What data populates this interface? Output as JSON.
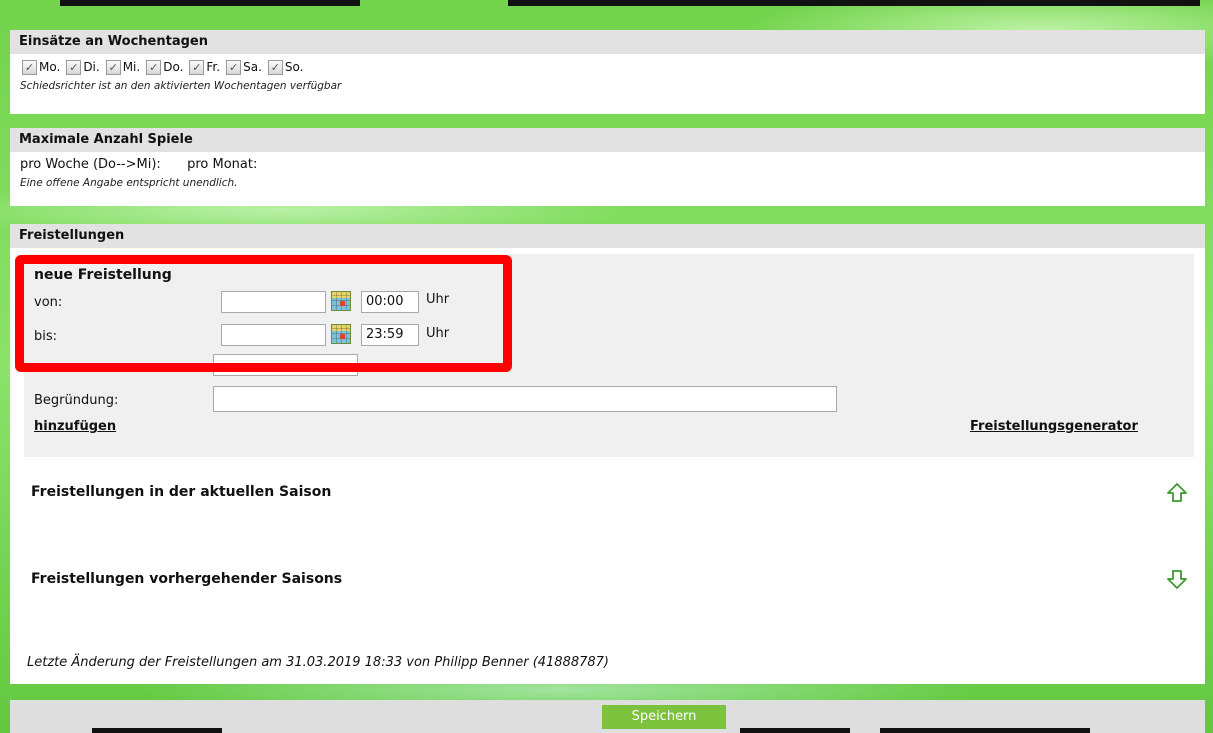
{
  "weekdays": {
    "title": "Einsätze an Wochentagen",
    "days": [
      "Mo.",
      "Di.",
      "Mi.",
      "Do.",
      "Fr.",
      "Sa.",
      "So."
    ],
    "note": "Schiedsrichter ist an den aktivierten Wochentagen verfügbar"
  },
  "max_games": {
    "title": "Maximale Anzahl Spiele",
    "per_week_label": "pro Woche (Do-->Mi):",
    "per_month_label": "pro Monat:",
    "note": "Eine offene Angabe entspricht unendlich."
  },
  "release": {
    "title": "Freistellungen",
    "new_title": "neue Freistellung",
    "from_label": "von:",
    "from_date": "",
    "from_time": "00:00",
    "to_label": "bis:",
    "to_date": "",
    "to_time": "23:59",
    "time_unit": "Uhr",
    "reason_label": "Begründung:",
    "reason_value": "",
    "add_link": "hinzufügen",
    "generator_link": "Freistellungsgenerator",
    "current_season": "Freistellungen in der aktuellen Saison",
    "previous_seasons": "Freistellungen vorhergehender Saisons",
    "last_change": "Letzte Änderung der Freistellungen am 31.03.2019 18:33 von Philipp Benner (41888787)"
  },
  "save_label": "Speichern",
  "colors": {
    "highlight": "#ff0000",
    "save_button": "#7cc23c",
    "header_bg": "#e2e2e2"
  }
}
